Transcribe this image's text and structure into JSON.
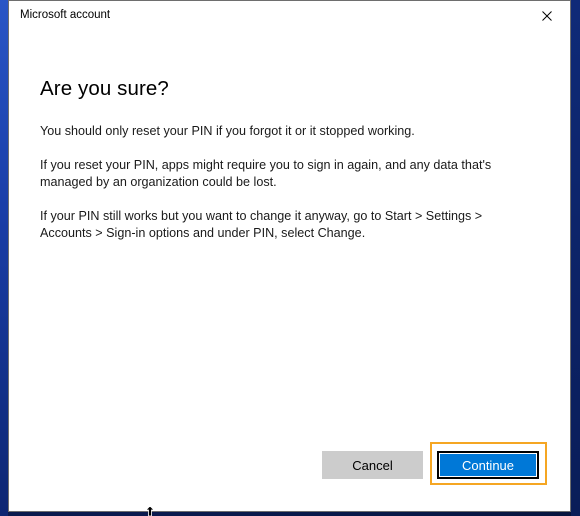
{
  "window": {
    "title": "Microsoft account",
    "close_label": "Close"
  },
  "dialog": {
    "heading": "Are you sure?",
    "paragraphs": [
      "You should only reset your PIN if you forgot it or it stopped working.",
      "If you reset your PIN, apps might require you to sign in again, and any data that's managed by an organization could be lost.",
      "If your PIN still works but you want to change it anyway, go to Start > Settings > Accounts > Sign-in options and under PIN, select Change."
    ]
  },
  "buttons": {
    "cancel_label": "Cancel",
    "continue_label": "Continue"
  },
  "icons": {
    "close": "close-icon",
    "cursor": "cursor-icon"
  },
  "colors": {
    "accent": "#0078d7",
    "focus_outline": "#f5a623",
    "cancel_bg": "#cccccc"
  }
}
